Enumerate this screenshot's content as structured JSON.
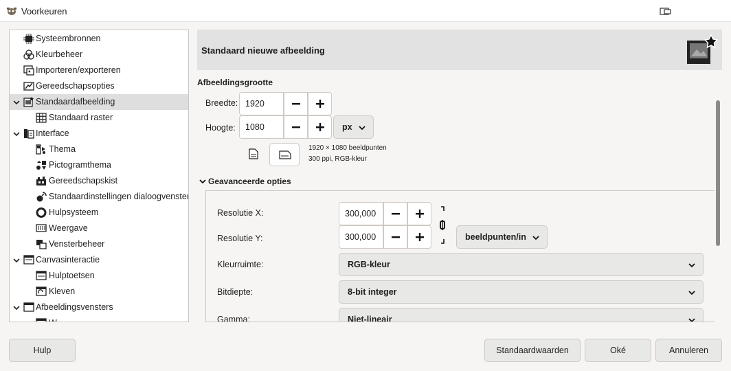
{
  "window": {
    "title": "Voorkeuren",
    "app_icon": "gimp-icon",
    "restore_icon": "window-restore-icon"
  },
  "tree": {
    "items": [
      {
        "label": "Systeembronnen",
        "icon": "chip-icon"
      },
      {
        "label": "Kleurbeheer",
        "icon": "color-circles-icon"
      },
      {
        "label": "Importeren/exporteren",
        "icon": "import-export-icon"
      },
      {
        "label": "Gereedschapsopties",
        "icon": "tool-options-icon"
      },
      {
        "label": "Standaardafbeelding",
        "icon": "image-icon",
        "expanded": true,
        "selected": true
      },
      {
        "label": "Standaard raster",
        "icon": "grid-icon"
      },
      {
        "label": "Interface",
        "icon": "interface-icon",
        "expanded": true
      },
      {
        "label": "Thema",
        "icon": "theme-icon"
      },
      {
        "label": "Pictogramthema",
        "icon": "icon-theme-icon"
      },
      {
        "label": "Gereedschapskist",
        "icon": "toolbox-icon"
      },
      {
        "label": "Standaardinstellingen dialoogvensters",
        "icon": "dialog-defaults-icon"
      },
      {
        "label": "Hulpsysteem",
        "icon": "lifebuoy-icon"
      },
      {
        "label": "Weergave",
        "icon": "display-icon"
      },
      {
        "label": "Vensterbeheer",
        "icon": "window-management-icon"
      },
      {
        "label": "Canvasinteractie",
        "icon": "canvas-icon",
        "expanded": true
      },
      {
        "label": "Hulptoetsen",
        "icon": "modifiers-icon"
      },
      {
        "label": "Kleven",
        "icon": "snapping-icon"
      },
      {
        "label": "Afbeeldingsvensters",
        "icon": "image-windows-icon",
        "expanded": true
      },
      {
        "label": "W",
        "icon": "appearance-icon"
      }
    ]
  },
  "header": {
    "title": "Standaard nieuwe afbeelding",
    "icon": "new-image-star-icon"
  },
  "image_size": {
    "section_title": "Afbeeldingsgrootte",
    "width_label": "Breedte:",
    "width_value": "1920",
    "height_label": "Hoogte:",
    "height_value": "1080",
    "unit": "px",
    "info_line1": "1920 × 1080 beeldpunten",
    "info_line2": "300 ppi, RGB-kleur",
    "portrait_icon": "portrait-icon",
    "landscape_icon": "landscape-icon"
  },
  "advanced": {
    "section_title": "Geavanceerde opties",
    "res_x_label": "Resolutie X:",
    "res_x_value": "300,000",
    "res_y_label": "Resolutie Y:",
    "res_y_value": "300,000",
    "res_unit": "beeldpunten/in",
    "colorspace_label": "Kleurruimte:",
    "colorspace_value": "RGB-kleur",
    "depth_label": "Bitdiepte:",
    "depth_value": "8-bit integer",
    "gamma_label": "Gamma:",
    "gamma_value": "Niet-lineair"
  },
  "buttons": {
    "help": "Hulp",
    "defaults": "Standaardwaarden",
    "ok": "Oké",
    "cancel": "Annuleren"
  }
}
